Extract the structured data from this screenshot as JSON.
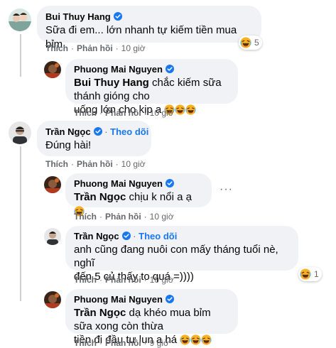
{
  "comments": [
    {
      "author": "Bui Thuy Hang",
      "text": "Sữa đi em... lớn nhanh tự kiếm tiền mua bỉm",
      "like": "Thích",
      "reply": "Phản hồi",
      "time": "10 giờ",
      "reaction_count": "5",
      "reaction_icon": "laughing-face-icon"
    },
    {
      "author": "Phuong Mai Nguyen",
      "mention": "Bui Thuy Hang",
      "text_line1": "chắc kiếm sữa thánh gióng cho",
      "text_line2": "uống lớn cho kịp ạ",
      "like": "Thích",
      "reply": "Phản hồi",
      "time": "10 giờ"
    },
    {
      "author": "Trần Ngọc",
      "follow": "Theo dõi",
      "text": "Đúng hài!",
      "like": "Thích",
      "reply": "Phản hồi",
      "time": "10 giờ"
    },
    {
      "author": "Phuong Mai Nguyen",
      "mention": "Trần Ngọc",
      "text": "chịu k nổi a ạ",
      "like": "Thích",
      "reply": "Phản hồi",
      "time": "10 giờ",
      "more_icon": "more-options-icon"
    },
    {
      "author": "Trần Ngọc",
      "follow": "Theo dõi",
      "text_line1": "anh cũng đang nuôi con mấy tháng tuổi nè, nghĩ",
      "text_line2": "đến 5 củ thấy to quá =))))",
      "like": "Thích",
      "reply": "Phản hồi",
      "time": "10 giờ",
      "reaction_count": "1",
      "reaction_icon": "laughing-face-icon"
    },
    {
      "author": "Phuong Mai Nguyen",
      "mention": "Trần Ngọc",
      "text_line1": "dạ khéo mua bỉm sữa xong còn thừa",
      "text_line2": "tiền đi đầu tư lun a há",
      "like": "Thích",
      "reply": "Phản hồi",
      "time": "9 giờ"
    }
  ],
  "colors": {
    "bubble": "#f0f2f5",
    "verified": "#1877f2",
    "follow": "#1877f2",
    "meta": "#65676b",
    "text": "#050505",
    "emoji": "#f7b125"
  }
}
